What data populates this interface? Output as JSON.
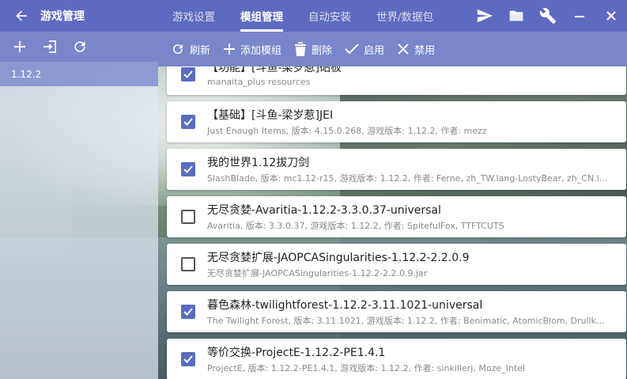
{
  "window": {
    "title": "游戏管理",
    "tabs": [
      {
        "label": "游戏设置"
      },
      {
        "label": "模组管理"
      },
      {
        "label": "自动安装"
      },
      {
        "label": "世界/数据包"
      }
    ],
    "active_tab": "模组管理",
    "icons": [
      "send-icon",
      "folder-icon",
      "wrench-icon",
      "minimize-icon",
      "close-icon"
    ]
  },
  "sidebar": {
    "actions": [
      "add-icon",
      "import-icon",
      "refresh-icon"
    ],
    "versions": [
      {
        "label": "1.12.2"
      }
    ]
  },
  "toolbar": {
    "refresh": "刷新",
    "add_mod": "添加模组",
    "delete": "删除",
    "enable": "启用",
    "disable": "禁用"
  },
  "mods": [
    {
      "title": "【功能】[斗鱼-梁岁惹]砧板",
      "subtitle": "manaita_plus resources",
      "enabled": true
    },
    {
      "title": "【基础】[斗鱼-梁岁惹]JEI",
      "subtitle": "Just Enough Items, 版本: 4.15.0.268, 游戏版本: 1.12.2, 作者: mezz",
      "enabled": true
    },
    {
      "title": "我的世界1.12拔刀剑",
      "subtitle": "SlashBlade, 版本: mc1.12-r15, 游戏版本: 1.12.2, 作者: Ferne, zh_TW.lang-LostyBear, zh_CN.l...",
      "enabled": true
    },
    {
      "title": "无尽贪婪-Avaritia-1.12.2-3.3.0.37-universal",
      "subtitle": "Avaritia, 版本: 3.3.0.37, 游戏版本: 1.12.2, 作者: SpitefulFox, TTFTCUTS",
      "enabled": false
    },
    {
      "title": "无尽贪婪扩展-JAOPCASingularities-1.12.2-2.2.0.9",
      "subtitle": "无尽贪婪扩展-JAOPCASingularities-1.12.2-2.2.0.9.jar",
      "enabled": false
    },
    {
      "title": "暮色森林-twilightforest-1.12.2-3.11.1021-universal",
      "subtitle": "The Twilight Forest, 版本: 3.11.1021, 游戏版本: 1.12.2, 作者: Benimatic, AtomicBlom, Drullk...",
      "enabled": true
    },
    {
      "title": "等价交换-ProjectE-1.12.2-PE1.4.1",
      "subtitle": "ProjectE, 版本: 1.12.2-PE1.4.1, 游戏版本: 1.12.2, 作者: sinkillerj, Moze_Intel",
      "enabled": true
    }
  ],
  "colors": {
    "primary": "#5c6bc0",
    "secondary": "#7986cb"
  }
}
